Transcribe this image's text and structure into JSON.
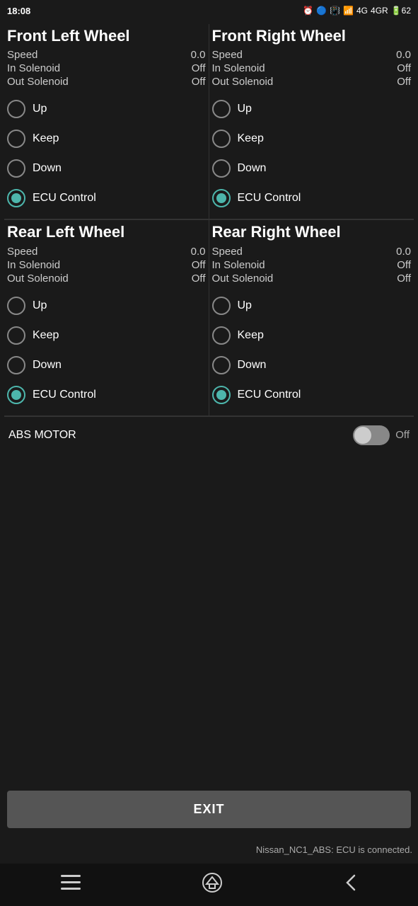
{
  "statusBar": {
    "time": "18:08",
    "rightIcons": "⏰ 🔵 📳 📶 4G 4GR 62"
  },
  "wheels": [
    {
      "id": "front-left",
      "title": "Front Left Wheel",
      "speed": "0.0",
      "inSolenoid": "Off",
      "outSolenoid": "Off",
      "options": [
        "Up",
        "Keep",
        "Down",
        "ECU Control"
      ],
      "selected": "ECU Control"
    },
    {
      "id": "front-right",
      "title": "Front Right Wheel",
      "speed": "0.0",
      "inSolenoid": "Off",
      "outSolenoid": "Off",
      "options": [
        "Up",
        "Keep",
        "Down",
        "ECU Control"
      ],
      "selected": "ECU Control"
    },
    {
      "id": "rear-left",
      "title": "Rear Left Wheel",
      "speed": "0.0",
      "inSolenoid": "Off",
      "outSolenoid": "Off",
      "options": [
        "Up",
        "Keep",
        "Down",
        "ECU Control"
      ],
      "selected": "ECU Control"
    },
    {
      "id": "rear-right",
      "title": "Rear Right Wheel",
      "speed": "0.0",
      "inSolenoid": "Off",
      "outSolenoid": "Off",
      "options": [
        "Up",
        "Keep",
        "Down",
        "ECU Control"
      ],
      "selected": "ECU Control"
    }
  ],
  "absMotor": {
    "label": "ABS MOTOR",
    "value": "Off",
    "enabled": false
  },
  "exitButton": "EXIT",
  "statusMessage": "Nissan_NC1_ABS: ECU is connected.",
  "labels": {
    "speed": "Speed",
    "inSolenoid": "In Solenoid",
    "outSolenoid": "Out Solenoid"
  },
  "nav": {
    "menu": "☰",
    "home": "⌂",
    "back": "‹"
  }
}
